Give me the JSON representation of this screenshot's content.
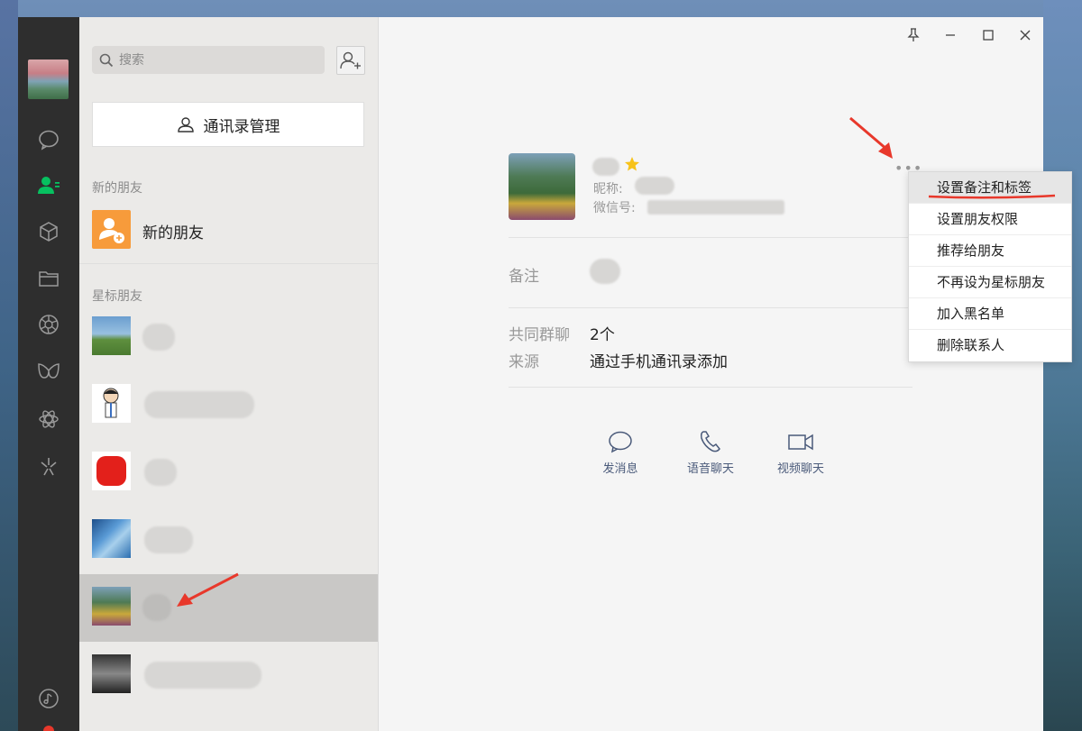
{
  "search": {
    "placeholder": "搜索"
  },
  "contacts_manager": {
    "label": "通讯录管理"
  },
  "sections": {
    "new_friends": "新的朋友",
    "starred": "星标朋友"
  },
  "new_friend_item": {
    "label": "新的朋友"
  },
  "profile": {
    "nickname_label": "昵称:",
    "wechat_id_label": "微信号:",
    "remark_label": "备注",
    "groups_label": "共同群聊",
    "groups_value": "2个",
    "source_label": "来源",
    "source_value": "通过手机通讯录添加",
    "more": "•••"
  },
  "actions": {
    "message": "发消息",
    "voice": "语音聊天",
    "video": "视频聊天"
  },
  "menu": {
    "items": [
      "设置备注和标签",
      "设置朋友权限",
      "推荐给朋友",
      "不再设为星标朋友",
      "加入黑名单",
      "删除联系人"
    ]
  },
  "colors": {
    "accent_green": "#07c160",
    "sidebar": "#2e2e2e",
    "new_friend_orange": "#f79b3b",
    "annotation_red": "#e8382b"
  },
  "icons": [
    "search-icon",
    "add-friend-icon",
    "chat-icon",
    "contacts-icon",
    "favorites-icon",
    "files-icon",
    "moments-icon",
    "channels-icon",
    "search-network-icon",
    "mini-programs-icon",
    "phone-icon",
    "settings-icon",
    "pin-icon",
    "minimize-icon",
    "maximize-icon",
    "close-icon",
    "star-icon",
    "voice-call-icon",
    "video-call-icon"
  ]
}
